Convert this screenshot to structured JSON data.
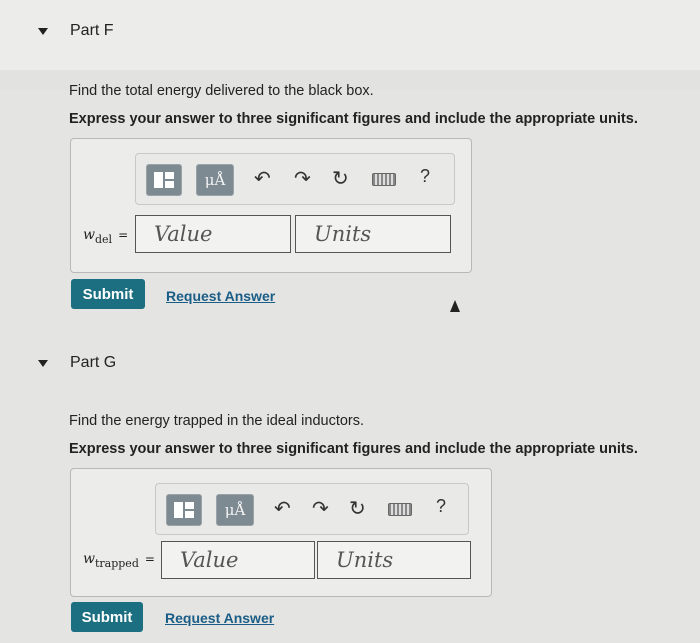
{
  "part_f": {
    "header": "Part F",
    "question": "Find the total energy delivered to the black box.",
    "instruction": "Express your answer to three significant figures and include the appropriate units.",
    "var_symbol": "w",
    "var_subscript": "del",
    "equals": "=",
    "value_placeholder": "Value",
    "units_placeholder": "Units",
    "submit_label": "Submit",
    "request_label": "Request Answer"
  },
  "part_g": {
    "header": "Part G",
    "question": "Find the energy trapped in the ideal inductors.",
    "instruction": "Express your answer to three significant figures and include the appropriate units.",
    "var_symbol": "w",
    "var_subscript": "trapped",
    "equals": "=",
    "value_placeholder": "Value",
    "units_placeholder": "Units",
    "submit_label": "Submit",
    "request_label": "Request Answer"
  },
  "toolbar": {
    "units_button": "μÅ",
    "undo_icon": "↶",
    "redo_icon": "↷",
    "reset_icon": "↻",
    "help_label": "?"
  },
  "icons": [
    "caret-down-icon",
    "template-icon",
    "undo-icon",
    "redo-icon",
    "reset-icon",
    "keyboard-icon",
    "help-icon"
  ],
  "colors": {
    "submit_bg": "#1b6f80",
    "link": "#1a5d86",
    "toolbar_button": "#7d8a92"
  }
}
